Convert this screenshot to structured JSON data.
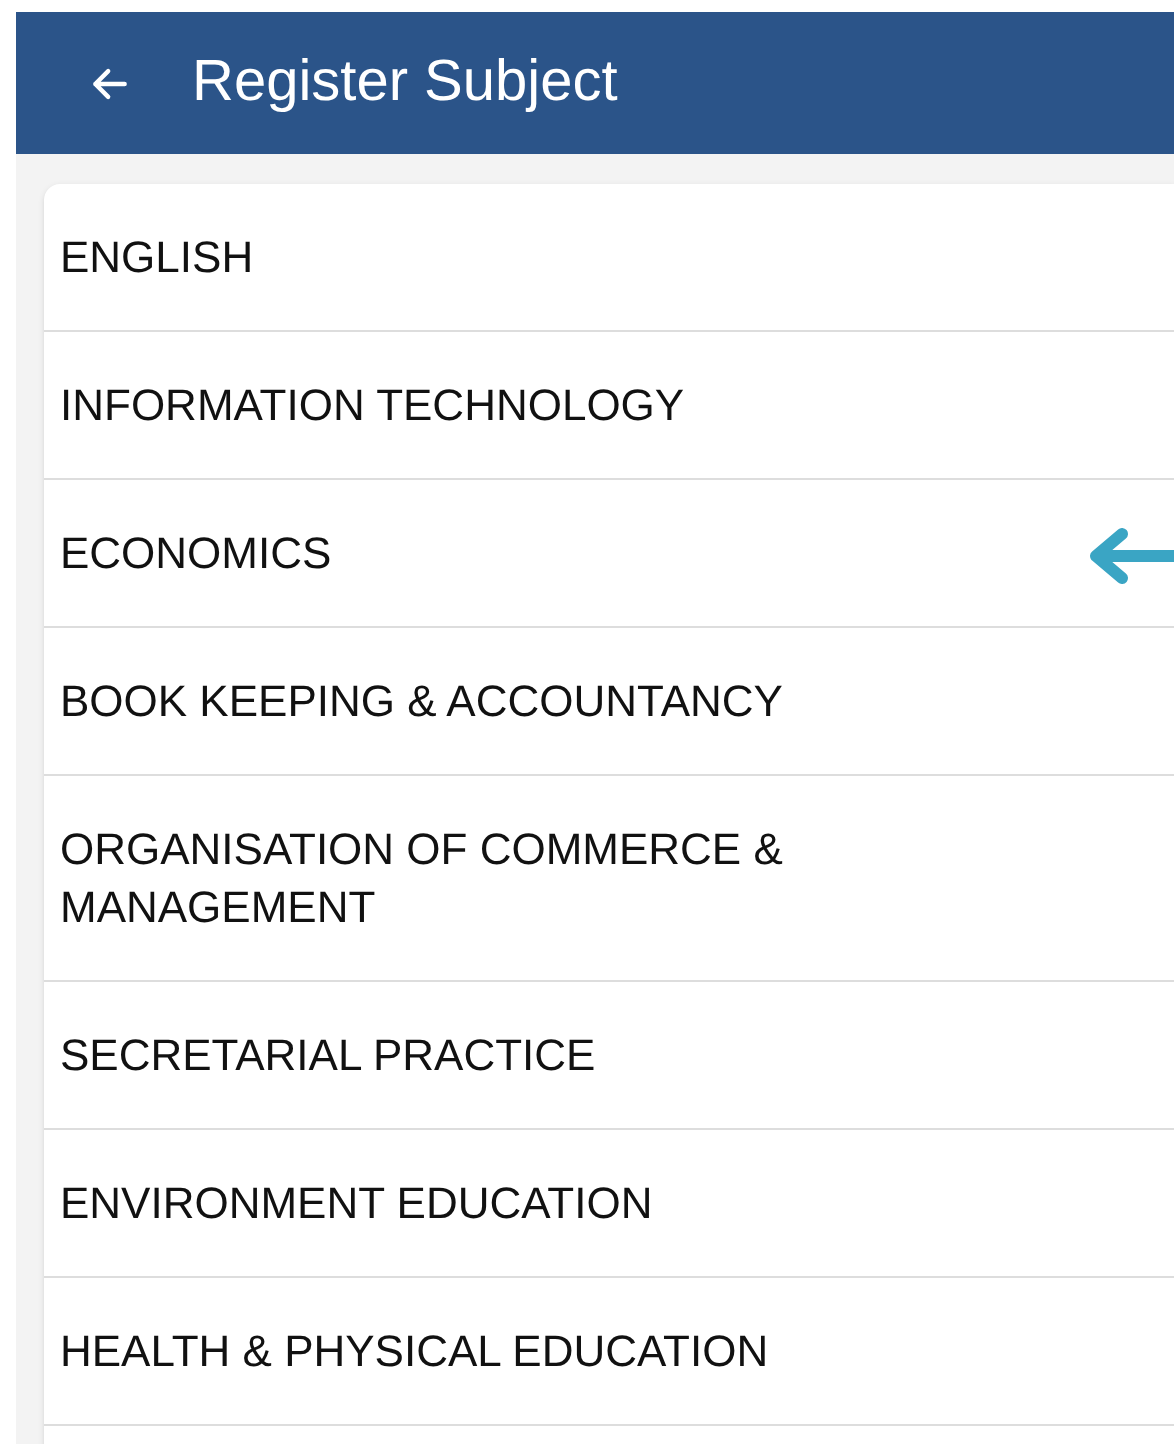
{
  "app_bar": {
    "title": "Register Subject"
  },
  "subjects": [
    {
      "name": "ENGLISH",
      "pointed": false
    },
    {
      "name": "INFORMATION TECHNOLOGY",
      "pointed": false
    },
    {
      "name": "ECONOMICS",
      "pointed": true
    },
    {
      "name": "BOOK KEEPING & ACCOUNTANCY",
      "pointed": false
    },
    {
      "name": "ORGANISATION OF COMMERCE & MANAGEMENT",
      "pointed": false
    },
    {
      "name": "SECRETARIAL PRACTICE",
      "pointed": false
    },
    {
      "name": "ENVIRONMENT EDUCATION",
      "pointed": false
    },
    {
      "name": "HEALTH & PHYSICAL EDUCATION",
      "pointed": false
    }
  ]
}
